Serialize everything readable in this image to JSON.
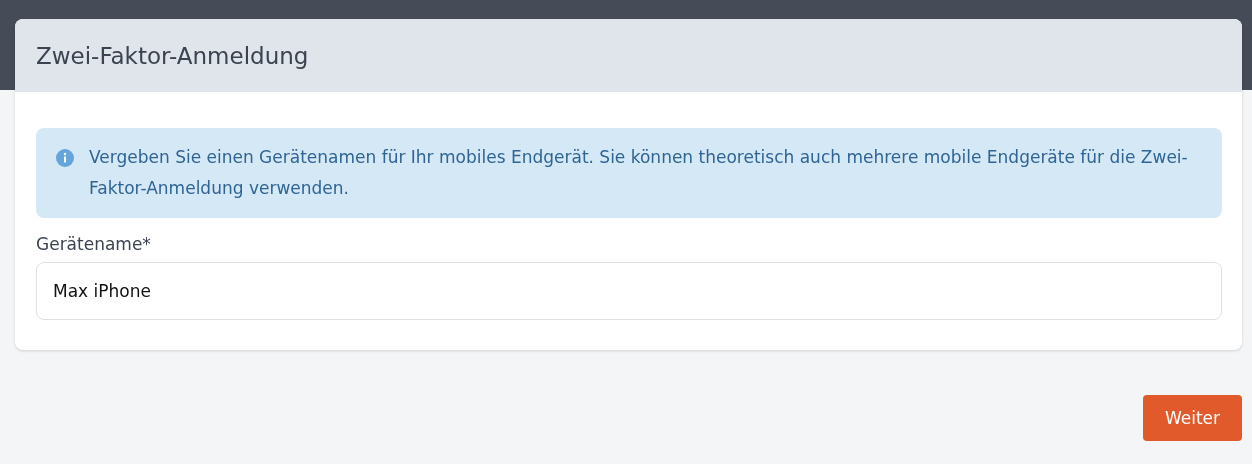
{
  "card": {
    "title": "Zwei-Faktor-Anmeldung",
    "info": "Vergeben Sie einen Gerätenamen für Ihr mobiles Endgerät. Sie können theoretisch auch mehrere mobile Endgeräte für die Zwei-Faktor-Anmeldung verwenden.",
    "field": {
      "label": "Gerätename*",
      "value": "Max iPhone"
    }
  },
  "buttons": [
    "Weiter"
  ]
}
